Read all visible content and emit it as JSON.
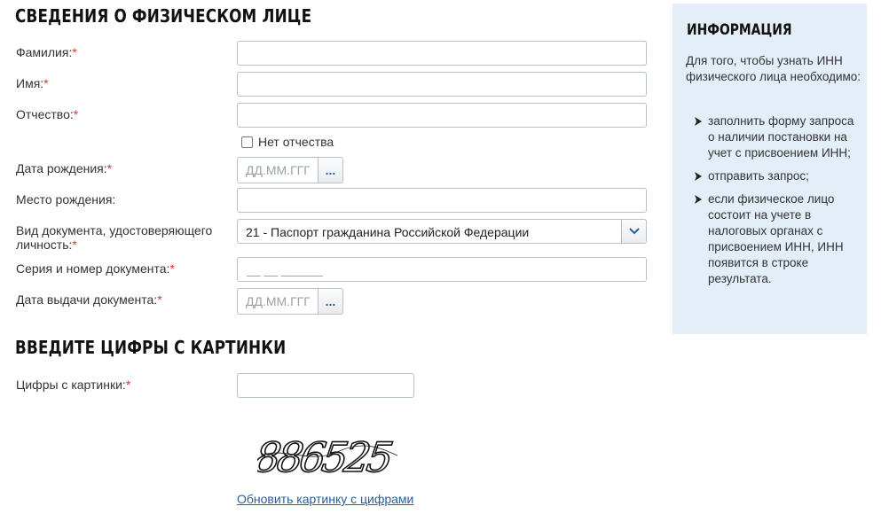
{
  "section1": {
    "title": "СВЕДЕНИЯ О ФИЗИЧЕСКОМ ЛИЦЕ"
  },
  "fields": {
    "surname": {
      "label": "Фамилия:",
      "value": ""
    },
    "name": {
      "label": "Имя:",
      "value": ""
    },
    "patronymic": {
      "label": "Отчество:",
      "value": ""
    },
    "no_patronymic": {
      "label": "Нет отчества",
      "checked": false
    },
    "birth_date": {
      "label": "Дата рождения:",
      "placeholder": "ДД.ММ.ГГГГ",
      "button": "..."
    },
    "birth_place": {
      "label": "Место рождения:",
      "value": ""
    },
    "doc_type": {
      "label_line1": "Вид документа, удостоверяющего",
      "label_line2": "личность:",
      "selected": "21 - Паспорт гражданина Российской Федерации"
    },
    "doc_number": {
      "label": "Серия и номер документа:",
      "placeholder": "__ __ ______"
    },
    "issue_date": {
      "label": "Дата выдачи документа:",
      "placeholder": "ДД.ММ.ГГГГ",
      "button": "..."
    }
  },
  "required_mark": "*",
  "section2": {
    "title": "ВВЕДИТЕ ЦИФРЫ С КАРТИНКИ"
  },
  "captcha": {
    "label": "Цифры с картинки:",
    "value": "",
    "image_digits": "886525",
    "refresh_link": "Обновить картинку с цифрами"
  },
  "info": {
    "title": "ИНФОРМАЦИЯ",
    "intro": "Для того, чтобы узнать ИНН физического лица необходимо:",
    "items": [
      "заполнить форму запроса о наличии постановки на учет с присвоением ИНН;",
      "отправить запрос;",
      "если физическое лицо состоит на учете в налоговых органах с присвоением ИНН, ИНН появится в строке результата."
    ]
  },
  "colors": {
    "info_bg": "#e3eef8",
    "required": "#d9352b",
    "link": "#2a5d9a",
    "border": "#b8c0c8"
  },
  "icons": {
    "select_arrow": "chevron-down-icon",
    "date_picker": "calendar-dots-icon",
    "info_bullet": "arrow-bullet-icon"
  }
}
